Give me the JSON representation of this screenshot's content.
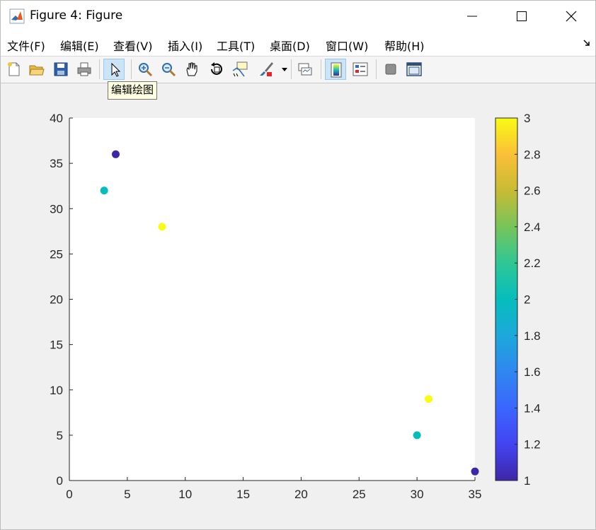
{
  "window": {
    "title": "Figure 4: Figure"
  },
  "menu": {
    "items": [
      "文件(F)",
      "编辑(E)",
      "查看(V)",
      "插入(I)",
      "工具(T)",
      "桌面(D)",
      "窗口(W)",
      "帮助(H)"
    ]
  },
  "toolbar": {
    "buttons": [
      "new-figure",
      "open-file",
      "save-figure",
      "print-figure",
      "edit-plot",
      "zoom-in",
      "zoom-out",
      "pan",
      "rotate-3d",
      "data-cursor",
      "brush",
      "link-plot",
      "colorbar-toggle",
      "legend-toggle",
      "hide-plot-tools",
      "show-plot-tools"
    ],
    "tooltip": "编辑绘图"
  },
  "colors": {
    "accent": "#0072bd",
    "toolbar_active": "#cce4f7"
  },
  "chart_data": {
    "type": "scatter",
    "x": [
      4,
      3,
      8,
      31,
      30,
      35
    ],
    "y": [
      36,
      32,
      28,
      9,
      5,
      1
    ],
    "c": [
      1,
      2,
      3,
      3,
      2,
      1
    ],
    "xlim": [
      0,
      35
    ],
    "ylim": [
      0,
      40
    ],
    "xticks": [
      0,
      5,
      10,
      15,
      20,
      25,
      30,
      35
    ],
    "yticks": [
      0,
      5,
      10,
      15,
      20,
      25,
      30,
      35,
      40
    ],
    "grid": false,
    "colormap": "parula",
    "colorbar": {
      "clim": [
        1,
        3
      ],
      "ticks": [
        1,
        1.2,
        1.4,
        1.6,
        1.8,
        2,
        2.2,
        2.4,
        2.6,
        2.8,
        3
      ],
      "placement": "right"
    }
  }
}
